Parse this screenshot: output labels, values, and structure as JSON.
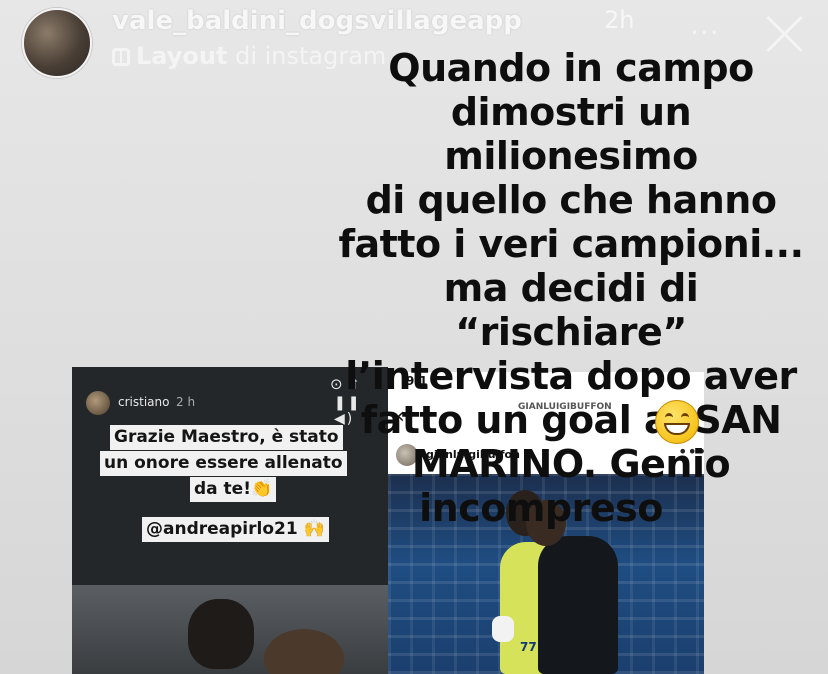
{
  "header": {
    "username": "vale_baldini_dogsvillageapp",
    "time": "2h",
    "layout_label": "Layout",
    "layout_suffix": "di instagram",
    "more": "...",
    "close": "×"
  },
  "caption": {
    "lines": [
      "Quando in campo",
      "dimostri un milionesimo",
      "di quello che hanno",
      "fatto i veri campioni...",
      "ma decidi di “rischiare”",
      "l’intervista dopo aver",
      "fatto un goal al SAN",
      "MARINO. Genio",
      "incompreso"
    ],
    "emoji": "grinning-face"
  },
  "left_story": {
    "user": "cristiano",
    "time": "2 h",
    "controls": "⊙ ⇧",
    "playback": "❚❚ ◀)",
    "message_lines": [
      "Grazie Maestro, è stato",
      "un onore essere allenato",
      "da te!👏"
    ],
    "mention": "@andreapirlo21 🙌"
  },
  "right_story": {
    "status_time": "9:1",
    "back": "‹",
    "handle_top": "GIANLUIGIBUFFON",
    "user": "gianluigibuffon",
    "verified": "✓",
    "menu": "•••",
    "jersey_number": "77"
  },
  "colors": {
    "background": "#e0e0e0",
    "caption_text": "#0e0e0e",
    "header_text": "#f7f7f7",
    "story_dark": "#202426",
    "pill_bg": "#f1f1f1",
    "pitch_blue": "#1f4d82",
    "keeper_yellow": "#d6e35a"
  }
}
